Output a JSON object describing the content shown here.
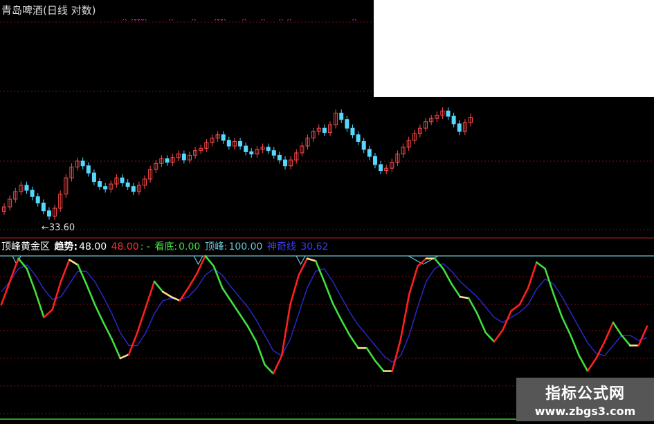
{
  "header": {
    "title": "青岛啤酒(日线 对数)"
  },
  "price_panel": {
    "low_label": "←33.60"
  },
  "indicator_header": {
    "name": "顶峰黄金区",
    "trend_label": "趋势:",
    "trend_value": "48.00",
    "red_value": "48.00",
    "sep": ": -",
    "bottom_label": "看底:",
    "bottom_value": "0.00",
    "peak_label": "顶峰:",
    "peak_value": "100.00",
    "signal_label": "神奇线",
    "signal_value": "30.62"
  },
  "watermark": {
    "line1": "指标公式网",
    "line2": "www.zbgs3.com"
  },
  "colors": {
    "up": "#ff4b4b",
    "down": "#54d8ff",
    "trend_up": "#ff2020",
    "trend_down": "#40e040",
    "transition": "#ffe08a",
    "slow": "#2828c8",
    "peak_line": "#6ac8d8",
    "marker": "#ff40ff"
  },
  "chart_data": [
    {
      "type": "candlestick",
      "title": "青岛啤酒(日线 对数)",
      "scale": "log",
      "annotations": [
        "←33.60"
      ],
      "close_approx": [
        34.6,
        35.2,
        35.8,
        36.3,
        35.9,
        35.4,
        34.9,
        34.3,
        33.9,
        34.5,
        35.6,
        36.9,
        37.8,
        38.3,
        37.9,
        37.3,
        36.6,
        36.2,
        36.0,
        36.4,
        36.9,
        36.5,
        36.2,
        35.8,
        36.3,
        36.8,
        37.6,
        38.1,
        38.5,
        38.2,
        38.6,
        38.9,
        38.4,
        38.8,
        39.2,
        39.4,
        39.9,
        40.3,
        40.6,
        40.1,
        39.6,
        40.0,
        39.6,
        39.1,
        38.9,
        39.3,
        39.5,
        39.2,
        38.8,
        38.4,
        37.9,
        38.4,
        39.0,
        39.6,
        40.3,
        40.9,
        41.2,
        40.8,
        41.5,
        42.6,
        42.0,
        41.2,
        40.6,
        40.0,
        39.3,
        38.7,
        38.0,
        37.5,
        37.7,
        38.2,
        38.9,
        39.5,
        40.1,
        40.7,
        41.2,
        41.8,
        42.1,
        42.4,
        42.8,
        42.3,
        41.6,
        40.9,
        41.7,
        42.2
      ],
      "series_low": 33.6
    },
    {
      "type": "line",
      "title": "顶峰黄金区",
      "ylim": [
        0,
        100
      ],
      "legend": [
        "趋势: 48.00",
        "看底: 0.00",
        "顶峰: 100.00",
        "神奇线 30.62"
      ],
      "series": [
        {
          "name": "趋势",
          "values": [
            62,
            80,
            98,
            90,
            72,
            52,
            58,
            80,
            97,
            93,
            78,
            62,
            48,
            35,
            20,
            23,
            40,
            60,
            80,
            72,
            68,
            65,
            75,
            86,
            100,
            92,
            75,
            65,
            55,
            45,
            33,
            15,
            8,
            22,
            62,
            85,
            98,
            96,
            80,
            63,
            50,
            38,
            28,
            28,
            18,
            10,
            10,
            35,
            70,
            92,
            98,
            98,
            90,
            78,
            68,
            67,
            55,
            40,
            33,
            42,
            57,
            62,
            75,
            95,
            90,
            70,
            52,
            38,
            22,
            10,
            20,
            33,
            48,
            38,
            30,
            30,
            45
          ]
        },
        {
          "name": "神奇线",
          "values": [
            72,
            80,
            90,
            93,
            85,
            74,
            66,
            68,
            78,
            88,
            88,
            80,
            68,
            55,
            40,
            30,
            30,
            40,
            55,
            65,
            67,
            66,
            68,
            75,
            85,
            90,
            85,
            76,
            68,
            60,
            50,
            38,
            26,
            22,
            35,
            55,
            75,
            88,
            90,
            80,
            68,
            56,
            46,
            38,
            30,
            22,
            17,
            22,
            38,
            60,
            80,
            90,
            94,
            88,
            80,
            74,
            68,
            60,
            52,
            48,
            52,
            56,
            62,
            74,
            82,
            78,
            68,
            56,
            44,
            32,
            24,
            22,
            30,
            38,
            38,
            34,
            36
          ]
        },
        {
          "name": "顶峰",
          "values": [
            100,
            100,
            100,
            100,
            100,
            100,
            100,
            100,
            100,
            100,
            100,
            100,
            100,
            100,
            100,
            100,
            100,
            100,
            100,
            100,
            100,
            100,
            100,
            100,
            100,
            100,
            100,
            100,
            100,
            100,
            100,
            100,
            100,
            100,
            100,
            100,
            100,
            100,
            100,
            100,
            100,
            100,
            100,
            100,
            100,
            100,
            100,
            100,
            100,
            100,
            100,
            100,
            100,
            100,
            100,
            100,
            100,
            100,
            100,
            100,
            100,
            100,
            100,
            100,
            100,
            100,
            100,
            100,
            100,
            100,
            100,
            100,
            100,
            100,
            100,
            100,
            100
          ]
        }
      ]
    }
  ]
}
